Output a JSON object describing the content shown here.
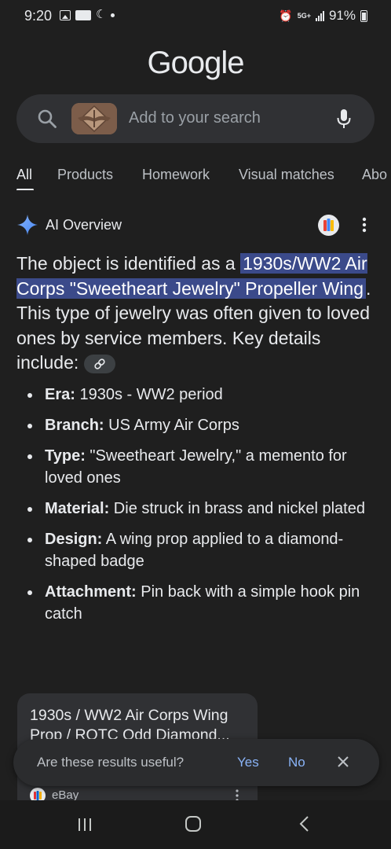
{
  "status_bar": {
    "time": "9:20",
    "battery": "91%",
    "network": "5G+"
  },
  "google_logo": "Google",
  "search": {
    "placeholder": "Add to your search"
  },
  "tabs": [
    {
      "label": "All",
      "active": true
    },
    {
      "label": "Products",
      "active": false
    },
    {
      "label": "Homework",
      "active": false
    },
    {
      "label": "Visual matches",
      "active": false
    },
    {
      "label": "Abo",
      "active": false
    }
  ],
  "ai_overview": {
    "title": "AI Overview",
    "intro_before": "The object is identified as a ",
    "highlight": "1930s/WW2 Air Corps \"Sweetheart Jewelry\" Propeller Wing",
    "intro_after": ". This type of jewelry was often given to loved ones by service members. Key details include: ",
    "details": [
      {
        "label": "Era:",
        "text": " 1930s - WW2 period"
      },
      {
        "label": "Branch:",
        "text": " US Army Air Corps"
      },
      {
        "label": "Type:",
        "text": " \"Sweetheart Jewelry,\" a memento for loved ones"
      },
      {
        "label": "Material:",
        "text": " Die struck in brass and nickel plated"
      },
      {
        "label": "Design:",
        "text": " A wing prop applied to a diamond-shaped badge"
      },
      {
        "label": "Attachment:",
        "text": " Pin back with a simple hook pin catch"
      }
    ]
  },
  "source_card": {
    "title": "1930s / WW2 Air Corps Wing Prop / ROTC Odd Diamond...",
    "source": "eBay"
  },
  "feedback": {
    "question": "Are these results useful?",
    "yes": "Yes",
    "no": "No"
  },
  "colors": {
    "background": "#1f1f1f",
    "highlight": "#3b4a8a",
    "link": "#8ab4f8"
  }
}
